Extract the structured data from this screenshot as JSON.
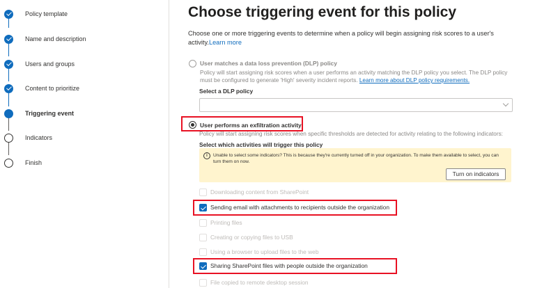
{
  "steps": [
    {
      "label": "Policy template",
      "state": "done"
    },
    {
      "label": "Name and description",
      "state": "done"
    },
    {
      "label": "Users and groups",
      "state": "done"
    },
    {
      "label": "Content to prioritize",
      "state": "done"
    },
    {
      "label": "Triggering event",
      "state": "current"
    },
    {
      "label": "Indicators",
      "state": "todo"
    },
    {
      "label": "Finish",
      "state": "todo"
    }
  ],
  "page": {
    "title": "Choose triggering event for this policy",
    "intro": "Choose one or more triggering events to determine when a policy will begin assigning risk scores to a user's activity.",
    "learn_more": "Learn more"
  },
  "option_dlp": {
    "title": "User matches a data loss prevention (DLP) policy",
    "desc": "Policy will start assigning risk scores when a user performs an activity matching the DLP policy you select. The DLP policy must be configured to generate 'High' severity incident reports.",
    "link": "Learn more about DLP policy requirements.",
    "select_label": "Select a DLP policy",
    "selected": false
  },
  "option_exfil": {
    "title": "User performs an exfiltration activity",
    "desc": "Policy will start assigning risk scores when specific thresholds are detected for activity relating to the following indicators:",
    "select_label": "Select which activities will trigger this policy",
    "selected": true
  },
  "warning": {
    "icon": "info-icon",
    "text": "Unable to select some indicators? This is because they're currently turned off in your organization. To make them available to select, you can turn them on now.",
    "button": "Turn on indicators"
  },
  "activities": [
    {
      "label": "Downloading content from SharePoint",
      "checked": false,
      "enabled": false
    },
    {
      "label": "Sending email with attachments to recipients outside the organization",
      "checked": true,
      "enabled": true
    },
    {
      "label": "Printing files",
      "checked": false,
      "enabled": false
    },
    {
      "label": "Creating or copying files to USB",
      "checked": false,
      "enabled": false
    },
    {
      "label": "Using a browser to upload files to the web",
      "checked": false,
      "enabled": false
    },
    {
      "label": "Sharing SharePoint files with people outside the organization",
      "checked": true,
      "enabled": true
    },
    {
      "label": "File copied to remote desktop session",
      "checked": false,
      "enabled": false
    }
  ],
  "colors": {
    "accent": "#0f6cbd",
    "highlight": "#e81123",
    "warning_bg": "#fff4ce"
  }
}
